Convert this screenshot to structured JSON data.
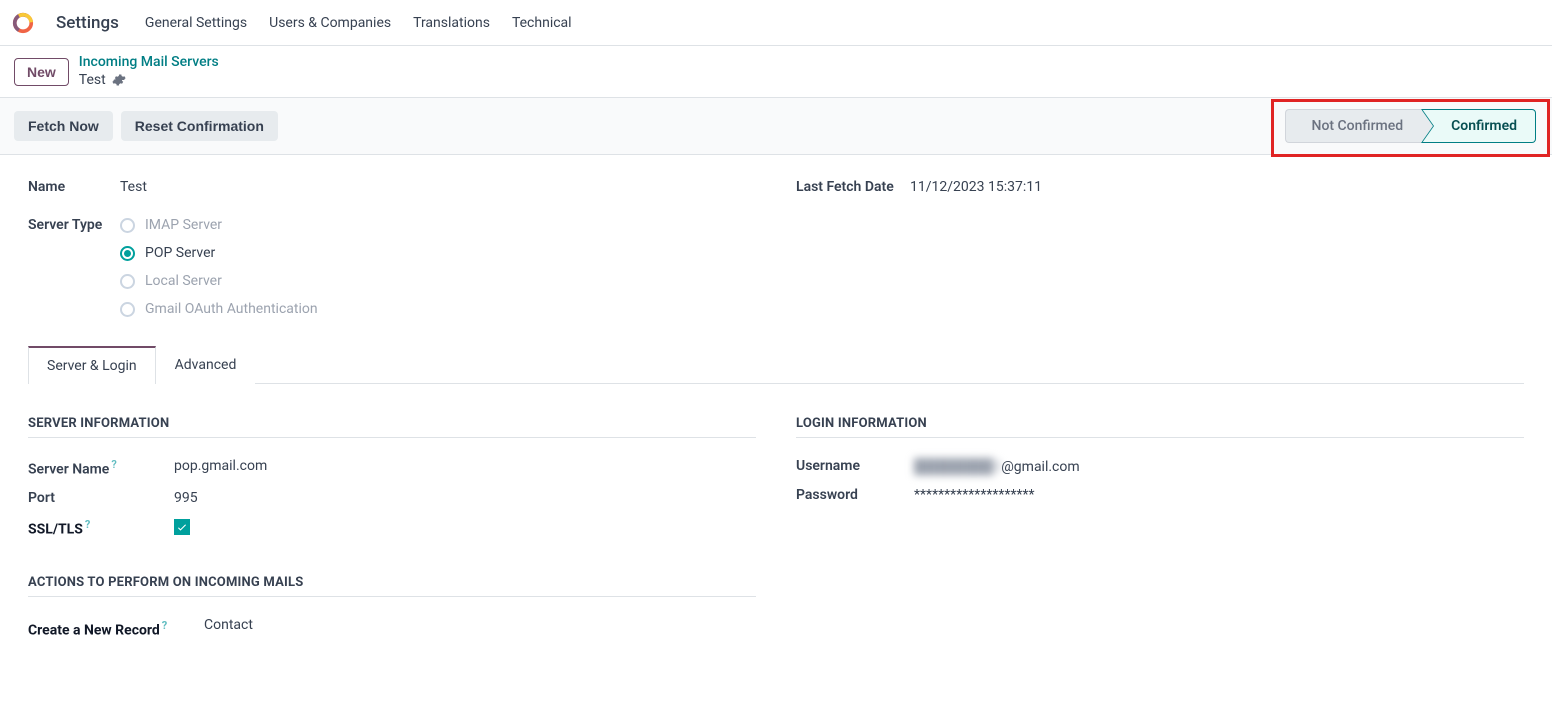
{
  "topbar": {
    "app_title": "Settings",
    "nav": [
      "General Settings",
      "Users & Companies",
      "Translations",
      "Technical"
    ]
  },
  "subheader": {
    "new_btn": "New",
    "breadcrumb_link": "Incoming Mail Servers",
    "breadcrumb_current": "Test"
  },
  "actions": {
    "fetch_now": "Fetch Now",
    "reset_conf": "Reset Confirmation"
  },
  "status": {
    "not_confirmed": "Not Confirmed",
    "confirmed": "Confirmed"
  },
  "form": {
    "name_label": "Name",
    "name_value": "Test",
    "last_fetch_label": "Last Fetch Date",
    "last_fetch_value": "11/12/2023 15:37:11",
    "server_type_label": "Server Type",
    "server_type_options": [
      "IMAP Server",
      "POP Server",
      "Local Server",
      "Gmail OAuth Authentication"
    ],
    "server_type_selected": 1
  },
  "tabs": [
    "Server & Login",
    "Advanced"
  ],
  "server_info": {
    "title": "Server Information",
    "server_name_label": "Server Name",
    "server_name_value": "pop.gmail.com",
    "port_label": "Port",
    "port_value": "995",
    "ssl_label": "SSL/TLS",
    "ssl_checked": true
  },
  "login_info": {
    "title": "Login Information",
    "username_label": "Username",
    "username_value_blurred": "████████3",
    "username_value_suffix": "@gmail.com",
    "password_label": "Password",
    "password_value": "********************"
  },
  "incoming_actions": {
    "title": "Actions to Perform on Incoming Mails",
    "create_record_label": "Create a New Record",
    "create_record_value": "Contact"
  }
}
